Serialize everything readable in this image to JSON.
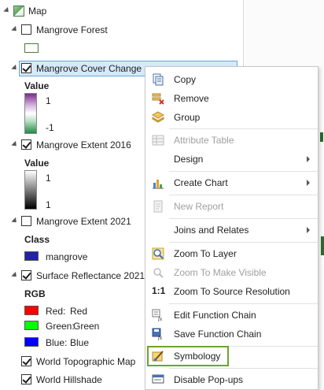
{
  "toc": {
    "map_label": "Map",
    "layers": [
      {
        "name": "Mangrove Forest",
        "checked": false
      },
      {
        "name": "Mangrove Cover Change",
        "checked": true,
        "legend_title": "Value",
        "ramp_high": "1",
        "ramp_low": "-1"
      },
      {
        "name": "Mangrove Extent 2016",
        "checked": true,
        "legend_title": "Value",
        "ramp_high": "1",
        "ramp_low": "1"
      },
      {
        "name": "Mangrove Extent 2021",
        "checked": false,
        "legend_title": "Class",
        "class_item": "mangrove"
      },
      {
        "name": "Surface Reflectance 2021",
        "checked": true,
        "legend_title": "RGB",
        "bands": [
          {
            "label": "Red:",
            "value": "Red",
            "color": "#ff0000"
          },
          {
            "label": "Green:",
            "value": "Green",
            "color": "#00ff00"
          },
          {
            "label": "Blue:",
            "value": "Blue",
            "color": "#0000ff"
          }
        ]
      },
      {
        "name": "World Topographic Map",
        "checked": true
      },
      {
        "name": "World Hillshade",
        "checked": true
      }
    ],
    "mangrove_class_color": "#2222aa"
  },
  "context_menu": {
    "items": [
      {
        "label": "Copy",
        "icon": "copy-icon",
        "enabled": true
      },
      {
        "label": "Remove",
        "icon": "remove-icon",
        "enabled": true
      },
      {
        "label": "Group",
        "icon": "group-icon",
        "enabled": true
      },
      {
        "label": "Attribute Table",
        "icon": "attribute-table-icon",
        "enabled": false
      },
      {
        "label": "Design",
        "icon": "",
        "enabled": true,
        "submenu": true
      },
      {
        "label": "Create Chart",
        "icon": "chart-icon",
        "enabled": true,
        "submenu": true
      },
      {
        "label": "New Report",
        "icon": "report-icon",
        "enabled": false
      },
      {
        "label": "Joins and Relates",
        "icon": "",
        "enabled": true,
        "submenu": true
      },
      {
        "label": "Zoom To Layer",
        "icon": "zoom-layer-icon",
        "enabled": true
      },
      {
        "label": "Zoom To Make Visible",
        "icon": "zoom-visible-icon",
        "enabled": false
      },
      {
        "label": "Zoom To Source Resolution",
        "icon": "one-to-one-icon",
        "icon_text": "1:1",
        "enabled": true
      },
      {
        "label": "Edit Function Chain",
        "icon": "edit-function-icon",
        "enabled": true
      },
      {
        "label": "Save Function Chain",
        "icon": "save-function-icon",
        "enabled": true
      },
      {
        "label": "Symbology",
        "icon": "symbology-icon",
        "enabled": true,
        "highlighted": true
      },
      {
        "label": "Disable Pop-ups",
        "icon": "popups-icon",
        "enabled": true
      }
    ]
  },
  "colors": {
    "selection_bg": "#d6e9f8",
    "selection_border": "#6aa8da",
    "highlight_border": "#6aa62e"
  }
}
